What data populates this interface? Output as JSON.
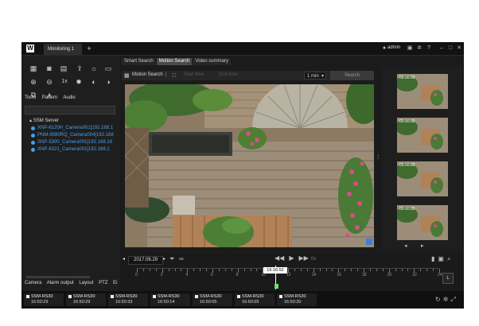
{
  "app": {
    "logo": "W",
    "tab": "Monitoring 1",
    "tab_add": "+",
    "user": "admin"
  },
  "toolbar_icons": [
    "grid-icon",
    "camera-icon",
    "print-icon",
    "export-icon",
    "monitor-icon",
    "zoom-in-icon",
    "zoom-out-icon",
    "speed-icon",
    "brightness-icon",
    "contrast-icon",
    "rotate-icon",
    "dewarp-icon"
  ],
  "speed_label": "1x",
  "left": {
    "tabs": [
      "Tools",
      "Pattern",
      "Audio"
    ],
    "tree": {
      "server": "SSM Server",
      "cameras": [
        "XNP-6120H_Camera001[192.168.1",
        "PNM-9080RQ_Camera004[192.168",
        "SNP-5300_Camera001[192.168.16",
        "XNP-6321_Camera001[192.168.1"
      ]
    },
    "bottom_tabs": [
      "Camera",
      "Alarm output",
      "Layout",
      "PTZ",
      "Ei"
    ]
  },
  "search": {
    "tabs": [
      "Smart Search",
      "Motion Search",
      "Video summary"
    ],
    "active_tab": "Motion Search",
    "motion_search_label": "Motion Search",
    "start_label": "Start time",
    "end_label": "End time",
    "duration": "1 min",
    "search_button": "Search"
  },
  "timeline": {
    "date": "2017.06.29",
    "current_time": "16:16:52",
    "speed": "0x",
    "hours": [
      "0",
      "2",
      "4",
      "6",
      "8",
      "10",
      "12",
      "14",
      "16",
      "18",
      "20",
      "22",
      "24"
    ],
    "l_button": "L"
  },
  "thumbs": [
    "00:00:00",
    "00:00:00",
    "00:00:00",
    "00:00:00"
  ],
  "status": {
    "cameras": [
      {
        "name": "SSM-RS30",
        "time": "16:50:29"
      },
      {
        "name": "SSM-RS30",
        "time": "16:50:29"
      },
      {
        "name": "SSM-RS30",
        "time": "16:50:33"
      },
      {
        "name": "SSM-RS30",
        "time": "16:50:14"
      },
      {
        "name": "SSM-RS30",
        "time": "16:50:05"
      },
      {
        "name": "SSM-RS30",
        "time": "16:50:05"
      },
      {
        "name": "SSM-RS30",
        "time": "16:50:30"
      }
    ]
  },
  "colors": {
    "accent": "#4a9fe6",
    "playhead_marker": "#6be06b"
  }
}
